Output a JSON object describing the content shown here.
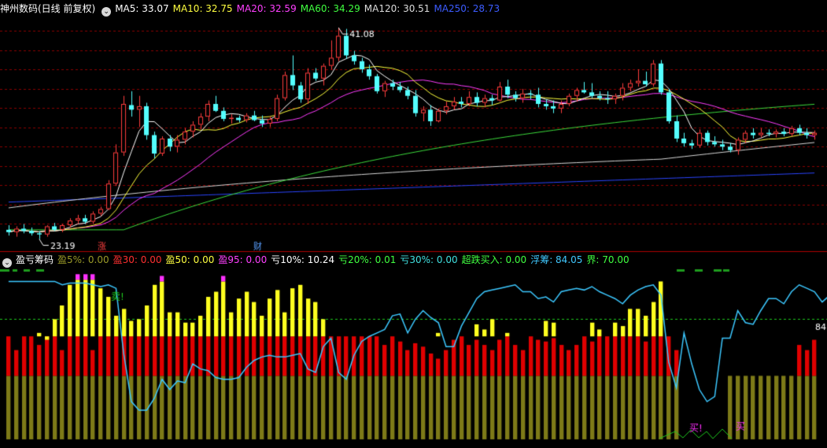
{
  "upper": {
    "title": "神州数码(日线 前复权)",
    "ma": [
      {
        "label": "MA5: 33.07",
        "color": "#ffffff"
      },
      {
        "label": "MA10: 32.75",
        "color": "#ffff40"
      },
      {
        "label": "MA20: 32.59",
        "color": "#ff40ff"
      },
      {
        "label": "MA60: 34.29",
        "color": "#40ff40"
      },
      {
        "label": "MA120: 30.51",
        "color": "#dcdcdc"
      },
      {
        "label": "MA250: 28.73",
        "color": "#3c5cff"
      }
    ],
    "high_label": "41.08",
    "low_label": "23.19",
    "marker_zhang": "涨",
    "marker_cai": "财"
  },
  "lower": {
    "title": "盈亏筹码",
    "items": [
      {
        "label": "盈5%: 0.00",
        "color": "#9a9a28"
      },
      {
        "label": "盈30: 0.00",
        "color": "#ff3030"
      },
      {
        "label": "盈50: 0.00",
        "color": "#ffff40"
      },
      {
        "label": "盈95: 0.00",
        "color": "#ff40ff"
      },
      {
        "label": "亏10%: 10.24",
        "color": "#ffffff"
      },
      {
        "label": "亏20%: 0.01",
        "color": "#40ff40"
      },
      {
        "label": "亏30%: 0.00",
        "color": "#40e0e0"
      },
      {
        "label": "超跌买入: 0.00",
        "color": "#40ff40"
      },
      {
        "label": "浮筹: 84.05",
        "color": "#40c8ff"
      },
      {
        "label": "界: 70.00",
        "color": "#40ff40"
      }
    ],
    "sell_label": "卖!",
    "buy_label_1": "买!",
    "buy_label_2": "买",
    "right_value": "84"
  },
  "colors": {
    "up": "#ff3c3c",
    "down": "#54ffff",
    "grid": "#8b0000",
    "cyan_line": "#3cc8ff"
  },
  "chart_data": {
    "type": "candlestick",
    "price_range": [
      22.5,
      42
    ],
    "candles": [
      [
        23.6,
        24.0,
        23.1,
        23.4
      ],
      [
        23.4,
        23.9,
        23.0,
        23.7
      ],
      [
        23.7,
        24.1,
        23.3,
        23.5
      ],
      [
        23.5,
        23.8,
        23.1,
        23.3
      ],
      [
        23.3,
        23.5,
        22.8,
        23.2
      ],
      [
        23.2,
        24.0,
        23.0,
        23.9
      ],
      [
        23.9,
        24.2,
        23.5,
        23.6
      ],
      [
        23.6,
        24.1,
        23.4,
        24.0
      ],
      [
        24.0,
        24.6,
        23.8,
        24.4
      ],
      [
        24.4,
        24.9,
        24.1,
        24.6
      ],
      [
        24.6,
        24.9,
        24.1,
        24.3
      ],
      [
        24.3,
        25.2,
        24.1,
        25.0
      ],
      [
        25.0,
        25.6,
        24.8,
        25.4
      ],
      [
        25.4,
        27.9,
        25.3,
        27.6
      ],
      [
        27.6,
        31.0,
        27.4,
        30.3
      ],
      [
        30.3,
        35.2,
        30.0,
        34.5
      ],
      [
        34.4,
        35.6,
        33.4,
        34.0
      ],
      [
        34.0,
        35.2,
        32.5,
        34.3
      ],
      [
        34.3,
        34.6,
        31.4,
        31.8
      ],
      [
        31.8,
        32.1,
        29.8,
        30.2
      ],
      [
        30.2,
        31.7,
        30.0,
        31.5
      ],
      [
        31.5,
        31.8,
        30.4,
        30.8
      ],
      [
        30.8,
        31.8,
        30.3,
        31.4
      ],
      [
        31.4,
        32.4,
        31.0,
        32.1
      ],
      [
        32.1,
        33.0,
        31.6,
        32.7
      ],
      [
        32.7,
        33.7,
        32.3,
        33.4
      ],
      [
        33.4,
        34.8,
        33.0,
        34.5
      ],
      [
        34.5,
        35.2,
        33.8,
        33.9
      ],
      [
        33.9,
        34.2,
        33.0,
        33.2
      ],
      [
        33.2,
        33.6,
        32.8,
        33.3
      ],
      [
        33.3,
        33.5,
        32.9,
        33.1
      ],
      [
        33.1,
        33.7,
        32.9,
        33.5
      ],
      [
        33.5,
        33.9,
        33.0,
        33.1
      ],
      [
        33.1,
        33.5,
        32.5,
        32.8
      ],
      [
        32.8,
        33.4,
        32.5,
        33.2
      ],
      [
        33.2,
        35.3,
        33.0,
        35.0
      ],
      [
        35.0,
        37.3,
        34.8,
        37.0
      ],
      [
        37.0,
        38.7,
        35.7,
        36.1
      ],
      [
        36.1,
        36.4,
        34.6,
        34.9
      ],
      [
        34.9,
        37.6,
        34.5,
        37.2
      ],
      [
        37.2,
        37.6,
        36.5,
        36.7
      ],
      [
        36.7,
        38.0,
        36.1,
        37.8
      ],
      [
        37.8,
        40.0,
        37.5,
        38.5
      ],
      [
        38.5,
        41.1,
        38.2,
        40.4
      ],
      [
        40.4,
        41.0,
        38.4,
        38.7
      ],
      [
        38.7,
        39.1,
        37.9,
        38.2
      ],
      [
        38.2,
        38.5,
        37.2,
        37.5
      ],
      [
        37.5,
        37.9,
        36.6,
        36.9
      ],
      [
        36.9,
        37.1,
        35.4,
        35.6
      ],
      [
        35.6,
        36.5,
        35.1,
        36.3
      ],
      [
        36.3,
        36.6,
        35.7,
        36.0
      ],
      [
        36.0,
        36.4,
        35.5,
        35.7
      ],
      [
        35.7,
        36.0,
        34.9,
        35.2
      ],
      [
        35.2,
        35.7,
        33.4,
        33.7
      ],
      [
        33.7,
        34.3,
        33.0,
        34.0
      ],
      [
        34.0,
        34.4,
        32.6,
        33.0
      ],
      [
        33.0,
        34.1,
        32.9,
        33.9
      ],
      [
        33.9,
        34.7,
        33.6,
        34.3
      ],
      [
        34.3,
        35.1,
        34.0,
        34.7
      ],
      [
        34.7,
        35.1,
        34.2,
        34.5
      ],
      [
        34.5,
        35.6,
        34.3,
        35.1
      ],
      [
        35.1,
        35.5,
        34.3,
        34.6
      ],
      [
        34.6,
        35.3,
        34.2,
        35.0
      ],
      [
        35.0,
        35.3,
        34.4,
        34.8
      ],
      [
        34.8,
        36.4,
        34.7,
        36.0
      ],
      [
        36.0,
        36.6,
        35.0,
        35.3
      ],
      [
        35.3,
        35.6,
        34.7,
        35.0
      ],
      [
        35.0,
        35.8,
        34.6,
        35.4
      ],
      [
        35.4,
        35.7,
        34.9,
        35.3
      ],
      [
        35.3,
        35.9,
        34.2,
        34.5
      ],
      [
        34.5,
        34.9,
        34.0,
        34.3
      ],
      [
        34.3,
        34.8,
        33.7,
        34.1
      ],
      [
        34.1,
        34.8,
        33.7,
        34.5
      ],
      [
        34.5,
        35.4,
        34.3,
        35.2
      ],
      [
        35.2,
        35.9,
        34.7,
        35.7
      ],
      [
        35.7,
        36.4,
        35.4,
        35.5
      ],
      [
        35.5,
        36.3,
        35.0,
        35.2
      ],
      [
        35.2,
        35.6,
        34.8,
        35.0
      ],
      [
        35.0,
        35.6,
        34.5,
        34.9
      ],
      [
        34.9,
        35.4,
        34.5,
        35.2
      ],
      [
        35.2,
        36.3,
        34.8,
        35.9
      ],
      [
        35.9,
        36.6,
        35.6,
        36.3
      ],
      [
        36.3,
        37.5,
        36.0,
        36.5
      ],
      [
        36.5,
        37.3,
        36.0,
        36.2
      ],
      [
        36.2,
        38.3,
        36.0,
        38.0
      ],
      [
        38.0,
        38.3,
        35.3,
        35.5
      ],
      [
        35.5,
        35.8,
        32.8,
        33.0
      ],
      [
        33.0,
        33.5,
        31.2,
        31.5
      ],
      [
        31.5,
        32.0,
        30.8,
        31.1
      ],
      [
        31.1,
        31.4,
        30.6,
        30.9
      ],
      [
        30.9,
        32.3,
        30.7,
        32.0
      ],
      [
        32.0,
        32.2,
        30.9,
        31.2
      ],
      [
        31.2,
        31.7,
        30.8,
        31.0
      ],
      [
        31.0,
        31.4,
        30.5,
        30.8
      ],
      [
        30.8,
        31.1,
        30.3,
        30.5
      ],
      [
        30.5,
        31.6,
        30.1,
        31.4
      ],
      [
        31.4,
        32.2,
        31.1,
        32.0
      ],
      [
        32.0,
        32.4,
        31.5,
        31.8
      ],
      [
        31.8,
        32.4,
        31.6,
        32.0
      ],
      [
        32.0,
        32.3,
        31.7,
        31.9
      ],
      [
        31.9,
        32.3,
        31.6,
        32.1
      ],
      [
        32.1,
        32.4,
        31.7,
        31.9
      ],
      [
        31.9,
        32.6,
        31.7,
        32.4
      ],
      [
        32.4,
        32.7,
        31.8,
        32.0
      ],
      [
        32.0,
        32.4,
        31.5,
        31.8
      ],
      [
        31.8,
        32.2,
        31.4,
        32.0
      ]
    ],
    "indicator_range": [
      0,
      100
    ],
    "boundary": 70,
    "float_chips": [
      92,
      92,
      92,
      92,
      92,
      92,
      92,
      90,
      91,
      91,
      91,
      90,
      89,
      90,
      88,
      50,
      22,
      17,
      17,
      24,
      35,
      29,
      34,
      33,
      44,
      41,
      40,
      36,
      35,
      35,
      36,
      42,
      46,
      48,
      49,
      48,
      48,
      49,
      50,
      41,
      39,
      54,
      59,
      39,
      35,
      49,
      57,
      60,
      62,
      64,
      72,
      73,
      62,
      70,
      75,
      71,
      68,
      54,
      54,
      66,
      74,
      82,
      86,
      87,
      88,
      89,
      90,
      86,
      86,
      82,
      83,
      80,
      86,
      87,
      88,
      87,
      89,
      86,
      84,
      82,
      79,
      84,
      87,
      89,
      90,
      84,
      45,
      30,
      62,
      44,
      29,
      22,
      25,
      59,
      59,
      75,
      68,
      67,
      75,
      82,
      82,
      79,
      86,
      90,
      88,
      86,
      80,
      84
    ],
    "bars_olive": [
      37,
      37,
      37,
      37,
      37,
      37,
      37,
      37,
      37,
      37,
      37,
      37,
      37,
      37,
      37,
      37,
      37,
      37,
      37,
      37,
      37,
      37,
      37,
      37,
      37,
      37,
      37,
      37,
      37,
      37,
      37,
      37,
      37,
      37,
      37,
      37,
      37,
      37,
      37,
      37,
      37,
      37,
      37,
      37,
      37,
      37,
      37,
      37,
      37,
      37,
      37,
      37,
      37,
      37,
      37,
      37,
      37,
      37,
      37,
      37,
      37,
      37,
      37,
      37,
      37,
      37,
      37,
      37,
      37,
      37,
      37,
      37,
      37,
      37,
      37,
      37,
      37,
      37,
      37,
      37,
      37,
      37,
      37,
      37,
      37,
      37,
      37,
      37,
      37,
      37,
      37,
      37,
      37,
      37,
      37,
      37,
      37,
      37,
      37,
      37,
      37,
      37,
      37,
      37,
      37,
      37,
      37,
      37
    ],
    "bars_red": [
      60,
      52,
      60,
      60,
      55,
      60,
      60,
      52,
      60,
      60,
      60,
      52,
      60,
      60,
      60,
      60,
      60,
      60,
      60,
      60,
      60,
      60,
      60,
      60,
      60,
      60,
      60,
      60,
      60,
      60,
      60,
      60,
      60,
      60,
      60,
      60,
      60,
      60,
      60,
      60,
      60,
      60,
      60,
      60,
      60,
      60,
      60,
      60,
      60,
      55,
      60,
      57,
      52,
      56,
      54,
      50,
      47,
      52,
      58,
      60,
      55,
      58,
      55,
      52,
      58,
      60,
      55,
      52,
      60,
      58,
      57,
      59,
      55,
      52,
      55,
      60,
      57,
      60,
      60,
      60,
      60,
      60,
      60,
      57,
      60,
      60,
      60,
      52,
      0,
      0,
      0,
      0,
      0,
      0,
      0,
      0,
      0,
      0,
      0,
      0,
      0,
      0,
      0,
      55,
      52,
      58,
      55,
      47
    ],
    "bars_yellow": [
      0,
      0,
      0,
      0,
      0,
      0,
      65,
      80,
      0,
      0,
      0,
      0,
      0,
      0,
      0,
      0,
      0,
      0,
      0,
      0,
      0,
      0,
      0,
      0,
      0,
      0,
      0,
      0,
      0,
      0,
      0,
      0,
      0,
      0,
      0,
      0,
      0,
      0,
      0,
      0,
      0,
      0,
      0,
      0,
      0,
      0,
      0,
      0,
      0,
      0,
      0,
      0,
      0,
      0,
      0,
      0,
      0,
      0,
      0,
      0,
      0,
      0,
      0,
      0,
      0,
      0,
      0,
      0,
      0,
      0,
      0,
      0,
      0,
      0,
      0,
      0,
      0,
      0,
      0,
      0,
      0,
      0,
      0,
      0,
      0,
      0,
      0,
      0,
      0,
      0,
      0,
      0,
      0,
      0,
      0,
      0,
      0,
      0,
      0,
      0,
      0,
      0,
      0,
      0,
      0,
      0,
      0,
      0
    ]
  }
}
